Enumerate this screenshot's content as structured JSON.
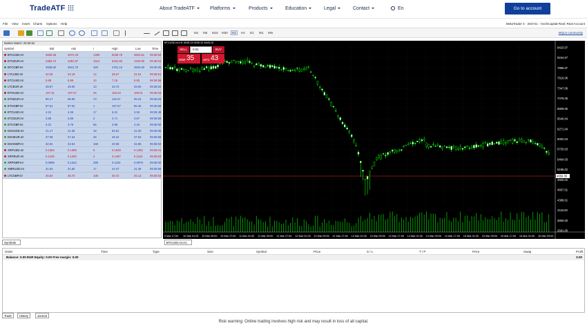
{
  "site": {
    "logo": "TradeATF",
    "nav": [
      {
        "label": "About TradeATF"
      },
      {
        "label": "Platforms"
      },
      {
        "label": "Products"
      },
      {
        "label": "Education"
      },
      {
        "label": "Legal"
      },
      {
        "label": "Contact"
      }
    ],
    "language": "En",
    "cta": "Go to account"
  },
  "mt": {
    "menu": [
      "File",
      "View",
      "Insert",
      "Charts",
      "Options",
      "Help"
    ],
    "window_title": "MetaTrader 4 - 284741 - HochCapital-Real: Real Account",
    "timeframes": [
      "M1",
      "M5",
      "M15",
      "M30",
      "H1",
      "H4",
      "D1",
      "W1",
      "MN"
    ],
    "active_timeframe": "H1",
    "mql_link": "MQL5 community"
  },
  "market_watch": {
    "title": "Market Watch: 09:36:52",
    "columns": [
      "Symbol",
      "Bid",
      "Ask",
      "!",
      "High",
      "Low",
      "Time"
    ],
    "rows": [
      {
        "symbol": "BTCUSD.m!",
        "bid": "4659.35",
        "ask": "4672.43",
        "spread": "1308",
        "high": "5038.76",
        "low": "4623.61",
        "time": "09:36:52",
        "dir": "dn"
      },
      {
        "symbol": "ETCEUR.m!",
        "bid": "4366.72",
        "ask": "4381.87",
        "spread": "1514",
        "high": "5332.83",
        "low": "4340.80",
        "time": "09:36:51",
        "dir": "dn"
      },
      {
        "symbol": "BTCGBP.m!",
        "bid": "3938.50",
        "ask": "3941.70",
        "spread": "320",
        "high": "4751.10",
        "low": "3933.50",
        "time": "09:36:00",
        "dir": "up"
      },
      {
        "symbol": "LTCUSD.m!",
        "bid": "32.06",
        "ask": "32.18",
        "spread": "12",
        "high": "38.67",
        "low": "31.51",
        "time": "09:36:51",
        "dir": "dn"
      },
      {
        "symbol": "ETCUSD.m!",
        "bid": "5.89",
        "ask": "5.99",
        "spread": "10",
        "high": "7.16",
        "low": "5.83",
        "time": "09:36:59",
        "dir": "dn"
      },
      {
        "symbol": "LTCEUR.m!",
        "bid": "28.87",
        "ask": "29.00",
        "spread": "13",
        "high": "34.72",
        "low": "28.50",
        "time": "09:36:02",
        "dir": "up"
      },
      {
        "symbol": "ETHUSD.m!",
        "bid": "107.31",
        "ask": "107.57",
        "spread": "26",
        "high": "153.33",
        "low": "106.01",
        "time": "09:36:03",
        "dir": "dn"
      },
      {
        "symbol": "ETHEUR.m!",
        "bid": "96.17",
        "ask": "96.90",
        "spread": "73",
        "high": "119.37",
        "low": "95.23",
        "time": "09:36:03",
        "dir": "up"
      },
      {
        "symbol": "ETHGBP.m!",
        "bid": "87.51",
        "ask": "87.52",
        "spread": "1",
        "high": "107.67",
        "low": "86.46",
        "time": "09:35:58",
        "dir": "up"
      },
      {
        "symbol": "ETCUSD.m!",
        "bid": "4.22",
        "ask": "4.39",
        "spread": "17",
        "high": "5.21",
        "low": "3.93",
        "time": "09:35:48",
        "dir": "up"
      },
      {
        "symbol": "ETCEUR.m!",
        "bid": "3.86",
        "ask": "3.88",
        "spread": "2",
        "high": "4.71",
        "low": "3.57",
        "time": "09:35:58",
        "dir": "up"
      },
      {
        "symbol": "ETCGBP.m!",
        "bid": "3.22",
        "ask": "3.78",
        "spread": "56",
        "high": "3.98",
        "low": "3.16",
        "time": "09:36:00",
        "dir": "up"
      },
      {
        "symbol": "DSHUSD.m!",
        "bid": "41.17",
        "ask": "41.35",
        "spread": "18",
        "high": "50.51",
        "low": "41.00",
        "time": "09:36:05",
        "dir": "up"
      },
      {
        "symbol": "DSHEUR.m!",
        "bid": "37.08",
        "ask": "37.34",
        "spread": "26",
        "high": "45.24",
        "low": "37.53",
        "time": "09:36:58",
        "dir": "up"
      },
      {
        "symbol": "DSHGBP.m!",
        "bid": "32.84",
        "ask": "34.53",
        "spread": "169",
        "high": "40.08",
        "low": "32.88",
        "time": "09:36:02",
        "dir": "up"
      },
      {
        "symbol": "XRPUSD.m!",
        "bid": "0.1384",
        "ask": "0.1389",
        "spread": "5",
        "high": "0.1639",
        "low": "0.1282",
        "time": "09:36:01",
        "dir": "dn"
      },
      {
        "symbol": "XRPEUR.m!",
        "bid": "0.1246",
        "ask": "0.1250",
        "spread": "4",
        "high": "0.1487",
        "low": "0.1152",
        "time": "09:36:53",
        "dir": "dn"
      },
      {
        "symbol": "XRPGBP.m!",
        "bid": "0.0995",
        "ask": "0.1264",
        "spread": "269",
        "high": "0.1192",
        "low": "0.0979",
        "time": "09:36:00",
        "dir": "up"
      },
      {
        "symbol": "XMRUSD.m!",
        "bid": "31.63",
        "ask": "31.80",
        "spread": "17",
        "high": "41.07",
        "low": "31.48",
        "time": "09:35:56",
        "dir": "up"
      },
      {
        "symbol": "LTCGBP.m!",
        "bid": "25.64",
        "ask": "26.70",
        "spread": "106",
        "high": "30.72",
        "low": "25.13",
        "time": "09:36:03",
        "dir": "dn"
      }
    ],
    "tab": "Symbols"
  },
  "chart": {
    "info": "BTCUSD.m!,H1  5035.23 5035.32 4845.15",
    "tab": "BTCUSD.m!,H1",
    "sell_label": "SELL",
    "buy_label": "BUY",
    "lot": "0.01",
    "sell_small": "4659",
    "sell_big": "35",
    "buy_small": "4672",
    "buy_big": "43",
    "current_price_label": "4659.35",
    "y_ticks": [
      "8423.07",
      "8154.07",
      "7885.07",
      "7616.06",
      "7347.06",
      "7078.05",
      "6809.05",
      "6540.04",
      "6271.04",
      "6002.04",
      "5733.03",
      "5464.03",
      "5195.02",
      "4926.02",
      "4657.01",
      "4388.01",
      "4119.00",
      "3850.00",
      "2581.00"
    ],
    "x_ticks": [
      "9 Mar 17:00",
      "10 Mar 01:00",
      "10 Mar 09:00",
      "10 Mar 17:00",
      "11 Mar 01:00",
      "11 Mar 09:00",
      "11 Mar 17:00",
      "12 Mar 01:00",
      "12 Mar 09:00",
      "12 Mar 17:00",
      "13 Mar 01:00",
      "13 Mar 09:00",
      "13 Mar 17:00",
      "14 Mar 01:00",
      "14 Mar 09:00",
      "14 Mar 17:00",
      "15 Mar 01:00",
      "15 Mar 09:00",
      "15 Mar 17:00",
      "16 Mar 01:00",
      "16 Mar 09:00"
    ]
  },
  "terminal": {
    "columns": [
      "Order",
      "Time",
      "Type",
      "Size",
      "Symbol",
      "Price",
      "S / L",
      "T / P",
      "Price",
      "Swap",
      "Profit"
    ],
    "balance_line": "Balance: 0.00 EUR  Equity: 0.00  Free margin: 0.00",
    "balance_value": "0.00",
    "tabs": [
      "Trade",
      "History",
      "Journal"
    ]
  },
  "risk_warning": "Risk warning: Online trading involves high risk and may result in loss of all capital.",
  "colors": {
    "brand": "#0a2f7a",
    "cta": "#0d3f9b",
    "sell": "#c0102a",
    "candle_up": "#00ff00",
    "bid_line": "#ff2a2a"
  }
}
